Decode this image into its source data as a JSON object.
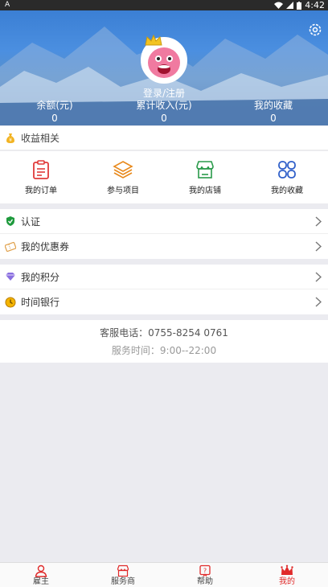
{
  "status_bar": {
    "left_icon": "A",
    "time": "4:42"
  },
  "profile": {
    "login_text": "登录/注册",
    "stats": [
      {
        "label": "余额(元)",
        "value": "0"
      },
      {
        "label": "累计收入(元)",
        "value": "0"
      },
      {
        "label": "我的收藏",
        "value": "0"
      }
    ]
  },
  "earnings_section": {
    "title": "收益相关"
  },
  "grid": [
    {
      "label": "我的订单",
      "icon": "order-icon",
      "color": "#e03a3a"
    },
    {
      "label": "参与项目",
      "icon": "layers-icon",
      "color": "#e8891c"
    },
    {
      "label": "我的店铺",
      "icon": "shop-icon",
      "color": "#2a9a4a"
    },
    {
      "label": "我的收藏",
      "icon": "favorites-icon",
      "color": "#2f5fc9"
    }
  ],
  "menu_group_1": [
    {
      "label": "认证",
      "icon": "shield-icon"
    },
    {
      "label": "我的优惠券",
      "icon": "coupon-icon"
    }
  ],
  "menu_group_2": [
    {
      "label": "我的积分",
      "icon": "diamond-icon"
    },
    {
      "label": "时间银行",
      "icon": "clock-icon"
    }
  ],
  "service": {
    "phone": "客服电话：0755-8254 0761",
    "hours": "服务时间：9:00--22:00"
  },
  "tabs": [
    {
      "label": "雇主",
      "icon": "person-icon",
      "active": false
    },
    {
      "label": "服务商",
      "icon": "store-icon",
      "active": false
    },
    {
      "label": "帮助",
      "icon": "help-icon",
      "active": false
    },
    {
      "label": "我的",
      "icon": "crown-icon",
      "active": true
    }
  ],
  "colors": {
    "accent": "#e02a2a",
    "hero_blue": "#3b7fd4"
  }
}
